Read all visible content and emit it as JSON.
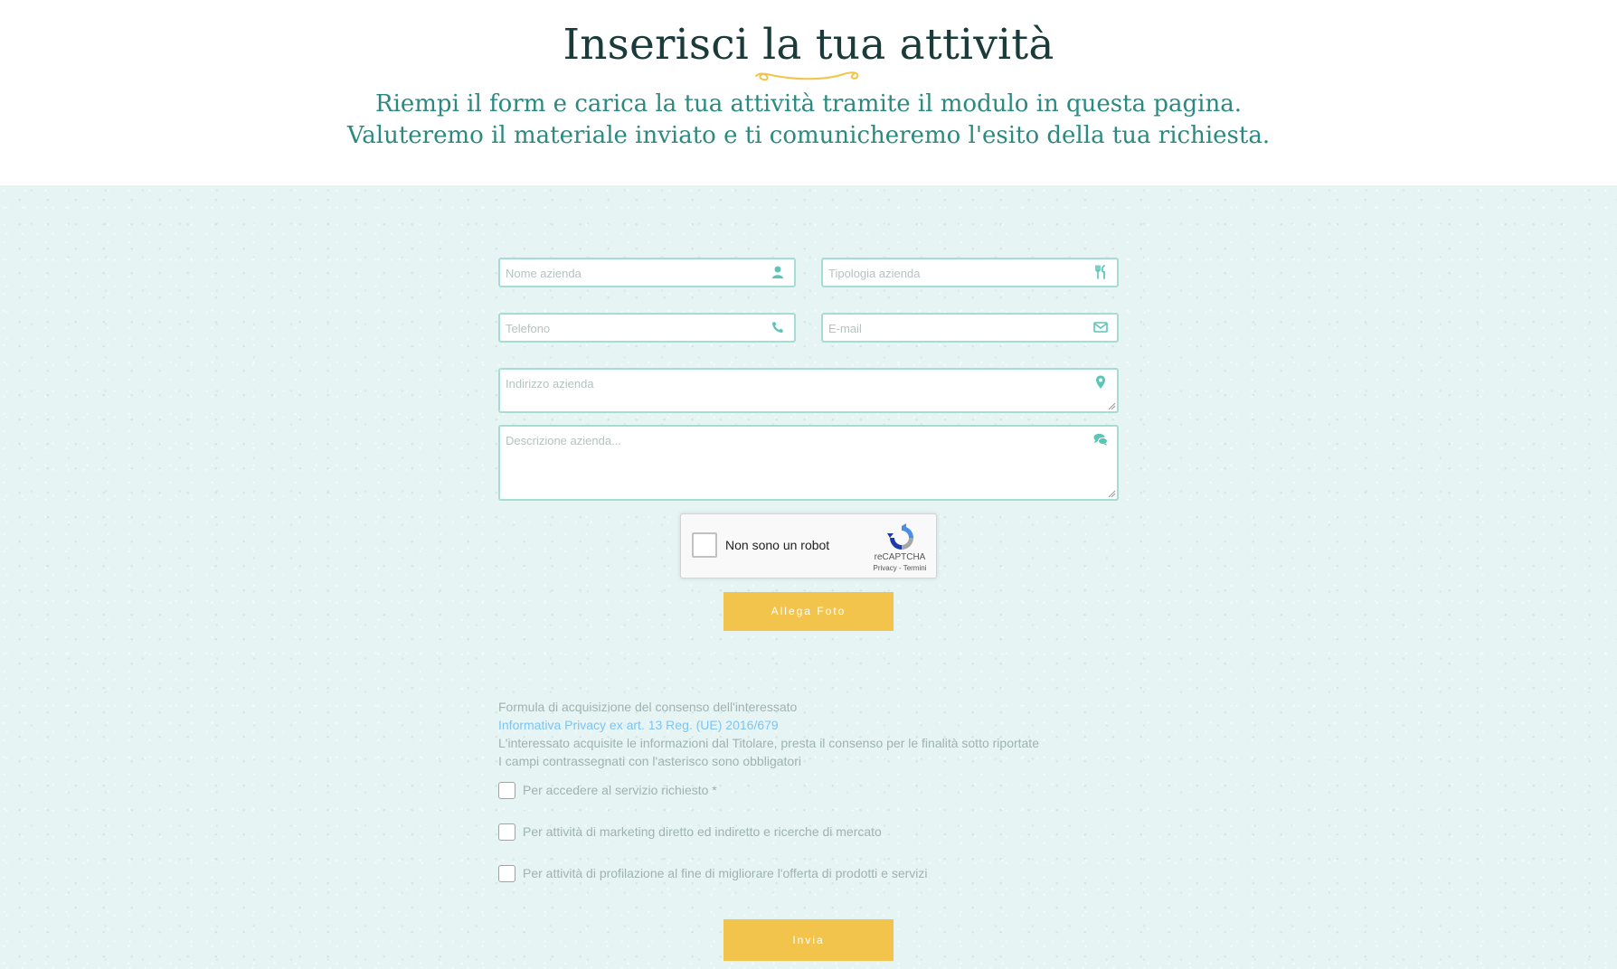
{
  "header": {
    "title": "Inserisci la tua attività",
    "subtitle_line1": "Riempi il form e carica la tua attività tramite il modulo in questa pagina.",
    "subtitle_line2": "Valuteremo il materiale inviato e ti comunicheremo l'esito della tua richiesta."
  },
  "form": {
    "nome_placeholder": "Nome azienda",
    "tipologia_placeholder": "Tipologia azienda",
    "telefono_placeholder": "Telefono",
    "email_placeholder": "E-mail",
    "indirizzo_placeholder": "Indirizzo azienda",
    "descrizione_placeholder": "Descrizione azienda...",
    "icons": {
      "nome": "user-icon",
      "tipologia": "fork-knife-icon",
      "telefono": "phone-icon",
      "email": "envelope-icon",
      "indirizzo": "map-pin-icon",
      "descrizione": "chat-bubbles-icon"
    }
  },
  "recaptcha": {
    "label": "Non sono un robot",
    "brand": "reCAPTCHA",
    "links": "Privacy - Termini"
  },
  "attach_button": "Allega Foto",
  "consent": {
    "line1": "Formula di acquisizione del consenso dell'interessato",
    "link": "Informativa Privacy ex art. 13 Reg. (UE) 2016/679",
    "line3": "L'interessato acquisite le informazioni dal Titolare, presta il consenso per le finalità sotto riportate",
    "line4": "I campi contrassegnati con l'asterisco sono obbligatori",
    "checkboxes": [
      "Per accedere al servizio richiesto *",
      "Per attività di marketing diretto ed indiretto e ricerche di mercato",
      "Per attività di profilazione al fine di migliorare l'offerta di prodotti e servizi"
    ]
  },
  "send_button": "Invia",
  "colors": {
    "accent_yellow": "#f3c44b",
    "teal_text": "#2b8a7f",
    "field_border": "#a6dcd6",
    "background": "#e6f4f3"
  }
}
